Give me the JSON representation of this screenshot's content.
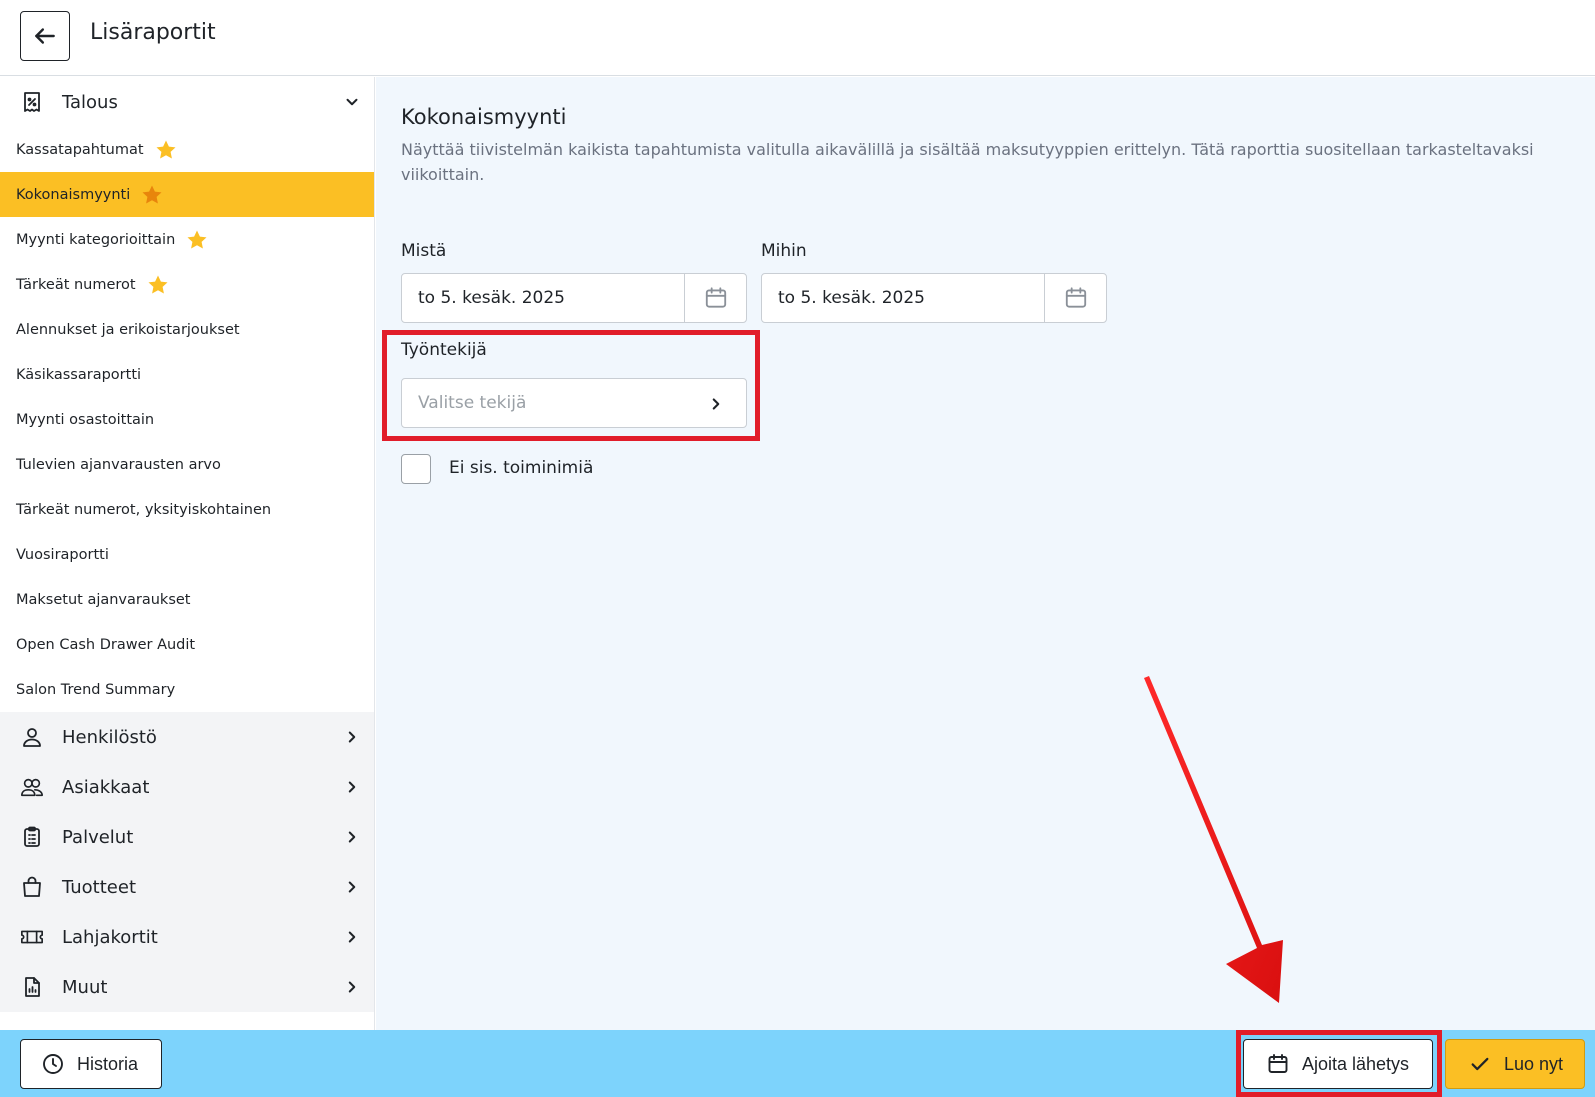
{
  "header": {
    "title": "Lisäraportit"
  },
  "sidebar": {
    "expanded_group": {
      "label": "Talous",
      "items": [
        {
          "label": "Kassatapahtumat",
          "starred": true,
          "active": false
        },
        {
          "label": "Kokonaismyynti",
          "starred": true,
          "active": true
        },
        {
          "label": "Myynti kategorioittain",
          "starred": true,
          "active": false
        },
        {
          "label": "Tärkeät numerot",
          "starred": true,
          "active": false
        },
        {
          "label": "Alennukset ja erikoistarjoukset",
          "starred": false,
          "active": false
        },
        {
          "label": "Käsikassaraportti",
          "starred": false,
          "active": false
        },
        {
          "label": "Myynti osastoittain",
          "starred": false,
          "active": false
        },
        {
          "label": "Tulevien ajanvarausten arvo",
          "starred": false,
          "active": false
        },
        {
          "label": "Tärkeät numerot, yksityiskohtainen",
          "starred": false,
          "active": false
        },
        {
          "label": "Vuosiraportti",
          "starred": false,
          "active": false
        },
        {
          "label": "Maksetut ajanvaraukset",
          "starred": false,
          "active": false
        },
        {
          "label": "Open Cash Drawer Audit",
          "starred": false,
          "active": false
        },
        {
          "label": "Salon Trend Summary",
          "starred": false,
          "active": false
        }
      ]
    },
    "groups": [
      {
        "label": "Henkilöstö",
        "icon": "person-icon"
      },
      {
        "label": "Asiakkaat",
        "icon": "users-icon"
      },
      {
        "label": "Palvelut",
        "icon": "clipboard-icon"
      },
      {
        "label": "Tuotteet",
        "icon": "shopping-bag-icon"
      },
      {
        "label": "Lahjakortit",
        "icon": "ticket-icon"
      },
      {
        "label": "Muut",
        "icon": "report-icon"
      }
    ]
  },
  "report": {
    "title": "Kokonaismyynti",
    "description": "Näyttää tiivistelmän kaikista tapahtumista valitulla aikavälillä ja sisältää maksutyyppien erittelyn. Tätä raporttia suositellaan tarkasteltavaksi viikoittain.",
    "from_label": "Mistä",
    "from_value": "to 5. kesäk. 2025",
    "to_label": "Mihin",
    "to_value": "to 5. kesäk. 2025",
    "employee_label": "Työntekijä",
    "employee_placeholder": "Valitse tekijä",
    "exclude_label": "Ei sis. toiminimiä",
    "exclude_checked": false
  },
  "footer": {
    "history_label": "Historia",
    "schedule_label": "Ajoita lähetys",
    "create_label": "Luo nyt"
  },
  "colors": {
    "accent": "#fbbf24",
    "footer_bg": "#7dd3fc",
    "main_bg": "#f1f7fd",
    "annotation_red": "#e11d2a"
  }
}
